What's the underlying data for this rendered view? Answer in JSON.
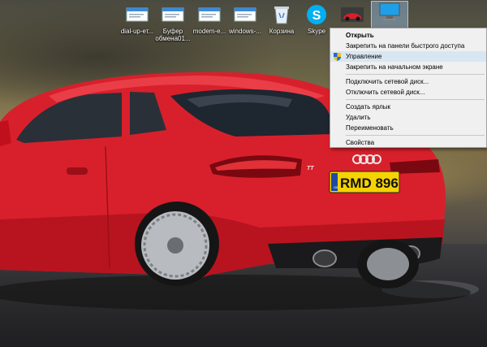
{
  "colors": {
    "car_body": "#d8202c",
    "menu_background": "#f0f0f0",
    "menu_hover": "#d8e6f2",
    "plate_yellow": "#f5d300",
    "skype_blue": "#00aff0"
  },
  "desktop_icons": [
    {
      "label": "dial-up-ет...",
      "icon": "text-file-icon"
    },
    {
      "label": "Буфер обмена01...",
      "icon": "text-file-icon"
    },
    {
      "label": "modem-e...",
      "icon": "text-file-icon"
    },
    {
      "label": "windows-...",
      "icon": "text-file-icon"
    },
    {
      "label": "Корзина",
      "icon": "recycle-bin-icon"
    },
    {
      "label": "Skype",
      "icon": "skype-icon"
    },
    {
      "label": "",
      "icon": "car-shortcut-icon"
    },
    {
      "label": "",
      "icon": "this-pc-icon"
    }
  ],
  "context_menu": {
    "items": [
      {
        "label": "Открыть",
        "bold": true
      },
      {
        "label": "Закрепить на панели быстрого доступа"
      },
      {
        "label": "Управление",
        "icon": "shield-icon",
        "hover": true
      },
      {
        "label": "Закрепить на начальном экране"
      },
      {
        "label": "Подключить сетевой диск..."
      },
      {
        "label": "Отключить сетевой диск..."
      },
      {
        "label": "Создать ярлык"
      },
      {
        "label": "Удалить"
      },
      {
        "label": "Переименовать"
      },
      {
        "label": "Свойства"
      }
    ]
  },
  "car": {
    "plate": "RMD 896",
    "plate_country": "GB",
    "badge": "TT"
  }
}
